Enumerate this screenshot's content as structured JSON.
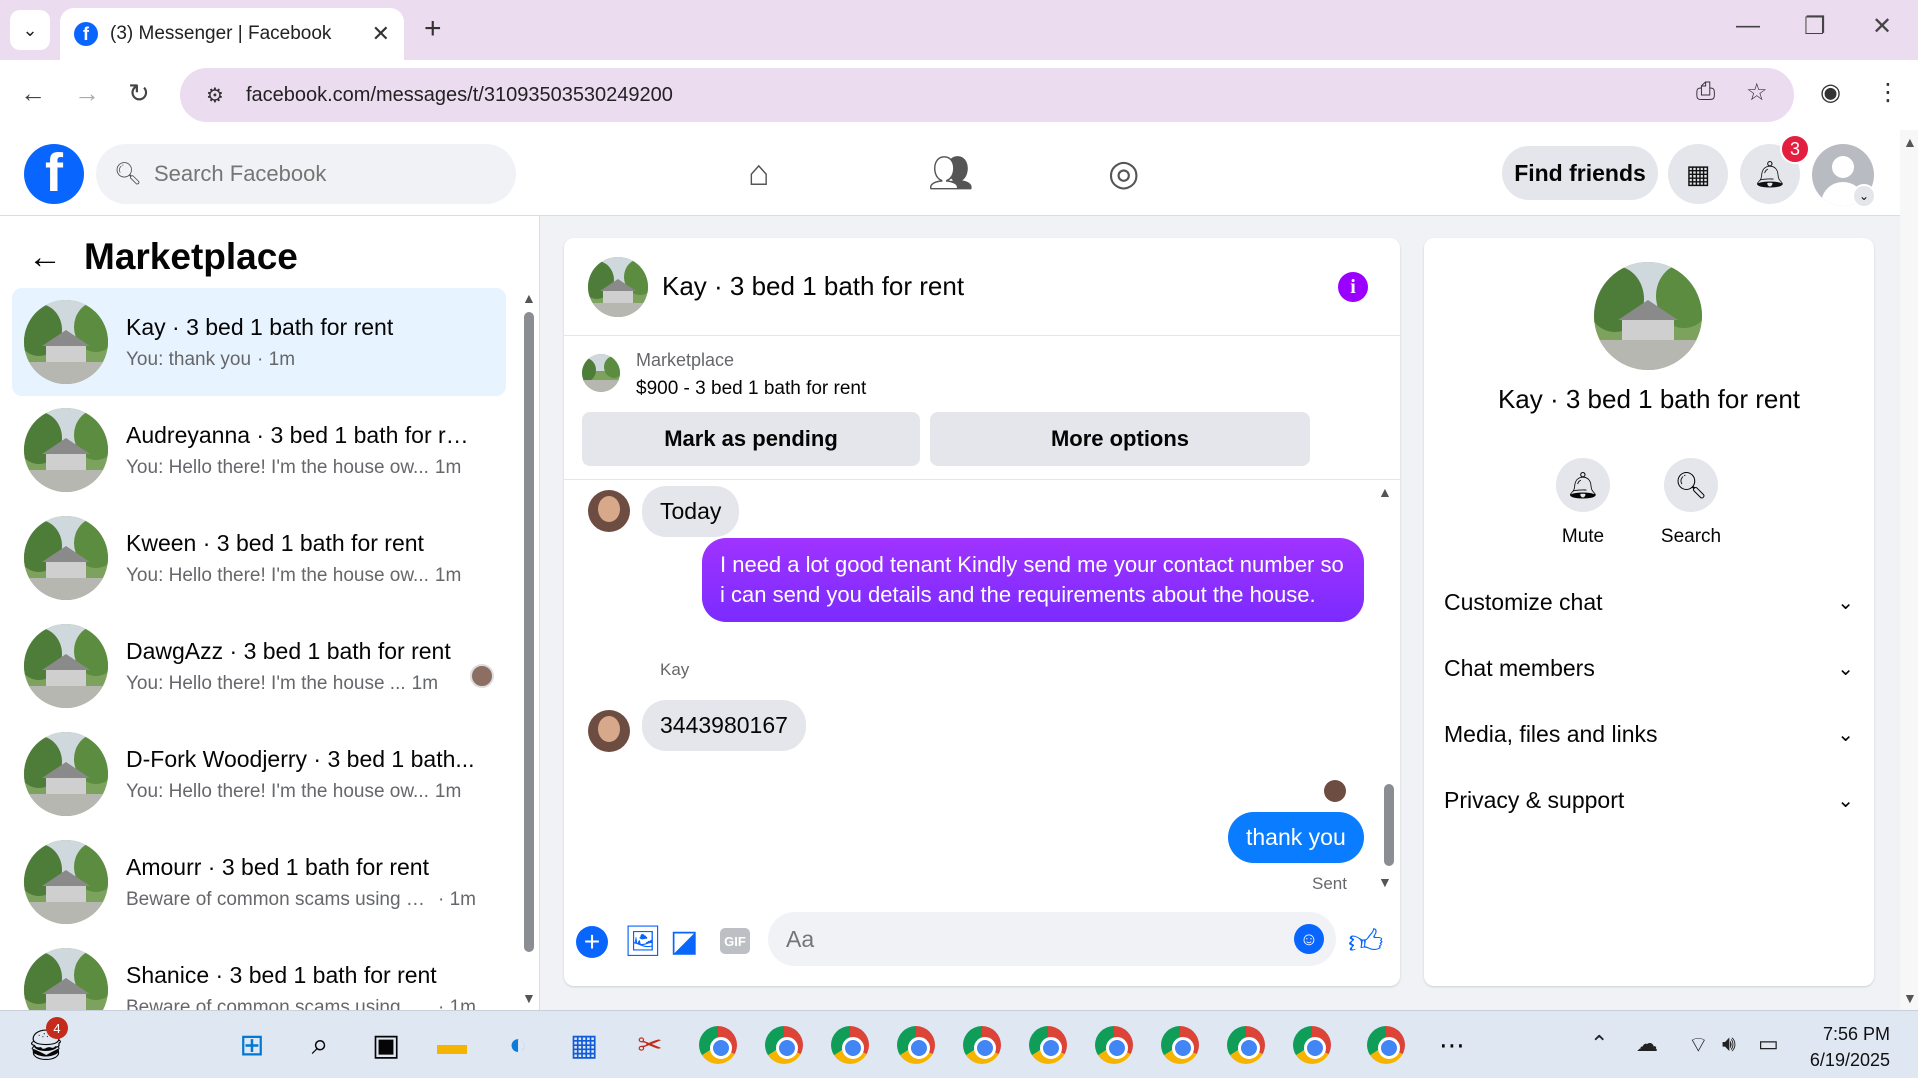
{
  "browser": {
    "tab_title": "(3) Messenger | Facebook",
    "url": "facebook.com/messages/t/31093503530249200"
  },
  "fb_header": {
    "search_placeholder": "Search Facebook",
    "find_friends": "Find friends",
    "notification_count": "3"
  },
  "left_panel": {
    "title": "Marketplace",
    "conversations": [
      {
        "name": "Kay · 3 bed 1 bath for rent",
        "preview": "You: thank you",
        "time": "· 1m",
        "active": true
      },
      {
        "name": "Audreyanna · 3 bed 1 bath for re...",
        "preview": "You: Hello there! I'm the house ow...",
        "time": "1m"
      },
      {
        "name": "Kween · 3 bed 1 bath for rent",
        "preview": "You: Hello there! I'm the house ow...",
        "time": "1m"
      },
      {
        "name": "DawgAzz · 3 bed 1 bath for rent",
        "preview": "You: Hello there! I'm the house ...",
        "time": "1m"
      },
      {
        "name": "D-Fork Woodjerry · 3 bed 1 bath...",
        "preview": "You: Hello there! I'm the house ow...",
        "time": "1m"
      },
      {
        "name": "Amourr · 3 bed 1 bath for rent",
        "preview": "Beware of common scams using p...",
        "time": "· 1m"
      },
      {
        "name": "Shanice · 3 bed 1 bath for rent",
        "preview": "Beware of common scams using p...",
        "time": "· 1m"
      }
    ]
  },
  "chat": {
    "title": "Kay · 3 bed 1 bath for rent",
    "marketplace_label": "Marketplace",
    "listing": "$900 - 3 bed 1 bath for rent",
    "mark_pending": "Mark as pending",
    "more_options": "More options",
    "messages": {
      "today": "Today",
      "outgoing_1": "I need a lot good tenant Kindly send me your contact number so i can send you details and the requirements about the house.",
      "sender": "Kay",
      "incoming_1": "3443980167",
      "outgoing_2": "thank you",
      "status": "Sent"
    },
    "composer_placeholder": "Aa"
  },
  "right_panel": {
    "name": "Kay · 3 bed 1 bath for rent",
    "mute": "Mute",
    "search": "Search",
    "sections": [
      "Customize chat",
      "Chat members",
      "Media, files and links",
      "Privacy & support"
    ]
  },
  "taskbar": {
    "badge": "4",
    "time": "7:56 PM",
    "date": "6/19/2025"
  }
}
